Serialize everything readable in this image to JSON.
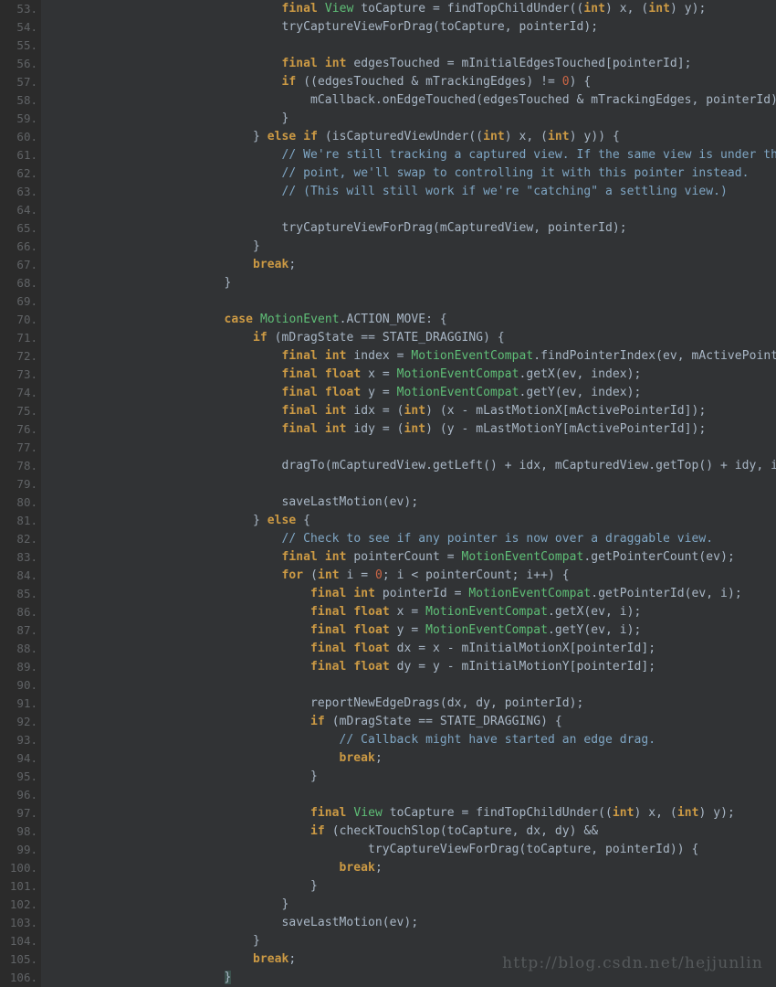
{
  "editor": {
    "language": "java",
    "first_line_number": 53,
    "last_line_number": 106,
    "line_number_suffix": ".",
    "colors": {
      "background": "#313335",
      "gutter_background": "#2b2b2b",
      "line_number": "#606366",
      "default_text": "#a9b7c6",
      "keyword": "#cc9a44",
      "type": "#5fbf77",
      "number": "#cc6645",
      "comment": "#7fa6c4",
      "brace_match_highlight": "#3b514d",
      "watermark": "#565a5c"
    }
  },
  "watermark": {
    "text": "http://blog.csdn.net/hejjunlin"
  },
  "lines": [
    {
      "num": "53.",
      "tokens": [
        {
          "t": "p",
          "s": "                    "
        },
        {
          "t": "k",
          "s": "final"
        },
        {
          "t": "p",
          "s": " "
        },
        {
          "t": "t",
          "s": "View"
        },
        {
          "t": "p",
          "s": " toCapture = findTopChildUnder(("
        },
        {
          "t": "k",
          "s": "int"
        },
        {
          "t": "p",
          "s": ") x, ("
        },
        {
          "t": "k",
          "s": "int"
        },
        {
          "t": "p",
          "s": ") y);"
        }
      ]
    },
    {
      "num": "54.",
      "tokens": [
        {
          "t": "p",
          "s": "                    tryCaptureViewForDrag(toCapture, pointerId);"
        }
      ]
    },
    {
      "num": "55.",
      "tokens": [
        {
          "t": "p",
          "s": ""
        }
      ]
    },
    {
      "num": "56.",
      "tokens": [
        {
          "t": "p",
          "s": "                    "
        },
        {
          "t": "k",
          "s": "final"
        },
        {
          "t": "p",
          "s": " "
        },
        {
          "t": "k",
          "s": "int"
        },
        {
          "t": "p",
          "s": " edgesTouched = mInitialEdgesTouched[pointerId];"
        }
      ]
    },
    {
      "num": "57.",
      "tokens": [
        {
          "t": "p",
          "s": "                    "
        },
        {
          "t": "k",
          "s": "if"
        },
        {
          "t": "p",
          "s": " ((edgesTouched & mTrackingEdges) != "
        },
        {
          "t": "n",
          "s": "0"
        },
        {
          "t": "p",
          "s": ") {"
        }
      ]
    },
    {
      "num": "58.",
      "tokens": [
        {
          "t": "p",
          "s": "                        mCallback.onEdgeTouched(edgesTouched & mTrackingEdges, pointerId);"
        }
      ]
    },
    {
      "num": "59.",
      "tokens": [
        {
          "t": "p",
          "s": "                    }"
        }
      ]
    },
    {
      "num": "60.",
      "tokens": [
        {
          "t": "p",
          "s": "                "
        },
        {
          "t": "p",
          "s": "} "
        },
        {
          "t": "k",
          "s": "else"
        },
        {
          "t": "p",
          "s": " "
        },
        {
          "t": "k",
          "s": "if"
        },
        {
          "t": "p",
          "s": " (isCapturedViewUnder(("
        },
        {
          "t": "k",
          "s": "int"
        },
        {
          "t": "p",
          "s": ") x, ("
        },
        {
          "t": "k",
          "s": "int"
        },
        {
          "t": "p",
          "s": ") y)) {"
        }
      ]
    },
    {
      "num": "61.",
      "tokens": [
        {
          "t": "p",
          "s": "                    "
        },
        {
          "t": "c",
          "s": "// We're still tracking a captured view. If the same view is under this"
        }
      ]
    },
    {
      "num": "62.",
      "tokens": [
        {
          "t": "p",
          "s": "                    "
        },
        {
          "t": "c",
          "s": "// point, we'll swap to controlling it with this pointer instead."
        }
      ]
    },
    {
      "num": "63.",
      "tokens": [
        {
          "t": "p",
          "s": "                    "
        },
        {
          "t": "c",
          "s": "// (This will still work if we're \"catching\" a settling view.)"
        }
      ]
    },
    {
      "num": "64.",
      "tokens": [
        {
          "t": "p",
          "s": ""
        }
      ]
    },
    {
      "num": "65.",
      "tokens": [
        {
          "t": "p",
          "s": "                    tryCaptureViewForDrag(mCapturedView, pointerId);"
        }
      ]
    },
    {
      "num": "66.",
      "tokens": [
        {
          "t": "p",
          "s": "                }"
        }
      ]
    },
    {
      "num": "67.",
      "tokens": [
        {
          "t": "p",
          "s": "                "
        },
        {
          "t": "k",
          "s": "break"
        },
        {
          "t": "p",
          "s": ";"
        }
      ]
    },
    {
      "num": "68.",
      "tokens": [
        {
          "t": "p",
          "s": "            }"
        }
      ]
    },
    {
      "num": "69.",
      "tokens": [
        {
          "t": "p",
          "s": ""
        }
      ]
    },
    {
      "num": "70.",
      "tokens": [
        {
          "t": "p",
          "s": "            "
        },
        {
          "t": "k",
          "s": "case"
        },
        {
          "t": "p",
          "s": " "
        },
        {
          "t": "t",
          "s": "MotionEvent"
        },
        {
          "t": "p",
          "s": ".ACTION_MOVE: {"
        }
      ]
    },
    {
      "num": "71.",
      "tokens": [
        {
          "t": "p",
          "s": "                "
        },
        {
          "t": "k",
          "s": "if"
        },
        {
          "t": "p",
          "s": " (mDragState == STATE_DRAGGING) {"
        }
      ]
    },
    {
      "num": "72.",
      "tokens": [
        {
          "t": "p",
          "s": "                    "
        },
        {
          "t": "k",
          "s": "final"
        },
        {
          "t": "p",
          "s": " "
        },
        {
          "t": "k",
          "s": "int"
        },
        {
          "t": "p",
          "s": " index = "
        },
        {
          "t": "t",
          "s": "MotionEventCompat"
        },
        {
          "t": "p",
          "s": ".findPointerIndex(ev, mActivePointerId);"
        }
      ]
    },
    {
      "num": "73.",
      "tokens": [
        {
          "t": "p",
          "s": "                    "
        },
        {
          "t": "k",
          "s": "final"
        },
        {
          "t": "p",
          "s": " "
        },
        {
          "t": "k",
          "s": "float"
        },
        {
          "t": "p",
          "s": " x = "
        },
        {
          "t": "t",
          "s": "MotionEventCompat"
        },
        {
          "t": "p",
          "s": ".getX(ev, index);"
        }
      ]
    },
    {
      "num": "74.",
      "tokens": [
        {
          "t": "p",
          "s": "                    "
        },
        {
          "t": "k",
          "s": "final"
        },
        {
          "t": "p",
          "s": " "
        },
        {
          "t": "k",
          "s": "float"
        },
        {
          "t": "p",
          "s": " y = "
        },
        {
          "t": "t",
          "s": "MotionEventCompat"
        },
        {
          "t": "p",
          "s": ".getY(ev, index);"
        }
      ]
    },
    {
      "num": "75.",
      "tokens": [
        {
          "t": "p",
          "s": "                    "
        },
        {
          "t": "k",
          "s": "final"
        },
        {
          "t": "p",
          "s": " "
        },
        {
          "t": "k",
          "s": "int"
        },
        {
          "t": "p",
          "s": " idx = ("
        },
        {
          "t": "k",
          "s": "int"
        },
        {
          "t": "p",
          "s": ") (x - mLastMotionX[mActivePointerId]);"
        }
      ]
    },
    {
      "num": "76.",
      "tokens": [
        {
          "t": "p",
          "s": "                    "
        },
        {
          "t": "k",
          "s": "final"
        },
        {
          "t": "p",
          "s": " "
        },
        {
          "t": "k",
          "s": "int"
        },
        {
          "t": "p",
          "s": " idy = ("
        },
        {
          "t": "k",
          "s": "int"
        },
        {
          "t": "p",
          "s": ") (y - mLastMotionY[mActivePointerId]);"
        }
      ]
    },
    {
      "num": "77.",
      "tokens": [
        {
          "t": "p",
          "s": ""
        }
      ]
    },
    {
      "num": "78.",
      "tokens": [
        {
          "t": "p",
          "s": "                    dragTo(mCapturedView.getLeft() + idx, mCapturedView.getTop() + idy, idx, idy);"
        }
      ]
    },
    {
      "num": "79.",
      "tokens": [
        {
          "t": "p",
          "s": ""
        }
      ]
    },
    {
      "num": "80.",
      "tokens": [
        {
          "t": "p",
          "s": "                    saveLastMotion(ev);"
        }
      ]
    },
    {
      "num": "81.",
      "tokens": [
        {
          "t": "p",
          "s": "                } "
        },
        {
          "t": "k",
          "s": "else"
        },
        {
          "t": "p",
          "s": " {"
        }
      ]
    },
    {
      "num": "82.",
      "tokens": [
        {
          "t": "p",
          "s": "                    "
        },
        {
          "t": "c",
          "s": "// Check to see if any pointer is now over a draggable view."
        }
      ]
    },
    {
      "num": "83.",
      "tokens": [
        {
          "t": "p",
          "s": "                    "
        },
        {
          "t": "k",
          "s": "final"
        },
        {
          "t": "p",
          "s": " "
        },
        {
          "t": "k",
          "s": "int"
        },
        {
          "t": "p",
          "s": " pointerCount = "
        },
        {
          "t": "t",
          "s": "MotionEventCompat"
        },
        {
          "t": "p",
          "s": ".getPointerCount(ev);"
        }
      ]
    },
    {
      "num": "84.",
      "tokens": [
        {
          "t": "p",
          "s": "                    "
        },
        {
          "t": "k",
          "s": "for"
        },
        {
          "t": "p",
          "s": " ("
        },
        {
          "t": "k",
          "s": "int"
        },
        {
          "t": "p",
          "s": " i = "
        },
        {
          "t": "n",
          "s": "0"
        },
        {
          "t": "p",
          "s": "; i < pointerCount; i++) {"
        }
      ]
    },
    {
      "num": "85.",
      "tokens": [
        {
          "t": "p",
          "s": "                        "
        },
        {
          "t": "k",
          "s": "final"
        },
        {
          "t": "p",
          "s": " "
        },
        {
          "t": "k",
          "s": "int"
        },
        {
          "t": "p",
          "s": " pointerId = "
        },
        {
          "t": "t",
          "s": "MotionEventCompat"
        },
        {
          "t": "p",
          "s": ".getPointerId(ev, i);"
        }
      ]
    },
    {
      "num": "86.",
      "tokens": [
        {
          "t": "p",
          "s": "                        "
        },
        {
          "t": "k",
          "s": "final"
        },
        {
          "t": "p",
          "s": " "
        },
        {
          "t": "k",
          "s": "float"
        },
        {
          "t": "p",
          "s": " x = "
        },
        {
          "t": "t",
          "s": "MotionEventCompat"
        },
        {
          "t": "p",
          "s": ".getX(ev, i);"
        }
      ]
    },
    {
      "num": "87.",
      "tokens": [
        {
          "t": "p",
          "s": "                        "
        },
        {
          "t": "k",
          "s": "final"
        },
        {
          "t": "p",
          "s": " "
        },
        {
          "t": "k",
          "s": "float"
        },
        {
          "t": "p",
          "s": " y = "
        },
        {
          "t": "t",
          "s": "MotionEventCompat"
        },
        {
          "t": "p",
          "s": ".getY(ev, i);"
        }
      ]
    },
    {
      "num": "88.",
      "tokens": [
        {
          "t": "p",
          "s": "                        "
        },
        {
          "t": "k",
          "s": "final"
        },
        {
          "t": "p",
          "s": " "
        },
        {
          "t": "k",
          "s": "float"
        },
        {
          "t": "p",
          "s": " dx = x - mInitialMotionX[pointerId];"
        }
      ]
    },
    {
      "num": "89.",
      "tokens": [
        {
          "t": "p",
          "s": "                        "
        },
        {
          "t": "k",
          "s": "final"
        },
        {
          "t": "p",
          "s": " "
        },
        {
          "t": "k",
          "s": "float"
        },
        {
          "t": "p",
          "s": " dy = y - mInitialMotionY[pointerId];"
        }
      ]
    },
    {
      "num": "90.",
      "tokens": [
        {
          "t": "p",
          "s": ""
        }
      ]
    },
    {
      "num": "91.",
      "tokens": [
        {
          "t": "p",
          "s": "                        reportNewEdgeDrags(dx, dy, pointerId);"
        }
      ]
    },
    {
      "num": "92.",
      "tokens": [
        {
          "t": "p",
          "s": "                        "
        },
        {
          "t": "k",
          "s": "if"
        },
        {
          "t": "p",
          "s": " (mDragState == STATE_DRAGGING) {"
        }
      ]
    },
    {
      "num": "93.",
      "tokens": [
        {
          "t": "p",
          "s": "                            "
        },
        {
          "t": "c",
          "s": "// Callback might have started an edge drag."
        }
      ]
    },
    {
      "num": "94.",
      "tokens": [
        {
          "t": "p",
          "s": "                            "
        },
        {
          "t": "k",
          "s": "break"
        },
        {
          "t": "p",
          "s": ";"
        }
      ]
    },
    {
      "num": "95.",
      "tokens": [
        {
          "t": "p",
          "s": "                        }"
        }
      ]
    },
    {
      "num": "96.",
      "tokens": [
        {
          "t": "p",
          "s": ""
        }
      ]
    },
    {
      "num": "97.",
      "tokens": [
        {
          "t": "p",
          "s": "                        "
        },
        {
          "t": "k",
          "s": "final"
        },
        {
          "t": "p",
          "s": " "
        },
        {
          "t": "t",
          "s": "View"
        },
        {
          "t": "p",
          "s": " toCapture = findTopChildUnder(("
        },
        {
          "t": "k",
          "s": "int"
        },
        {
          "t": "p",
          "s": ") x, ("
        },
        {
          "t": "k",
          "s": "int"
        },
        {
          "t": "p",
          "s": ") y);"
        }
      ]
    },
    {
      "num": "98.",
      "tokens": [
        {
          "t": "p",
          "s": "                        "
        },
        {
          "t": "k",
          "s": "if"
        },
        {
          "t": "p",
          "s": " (checkTouchSlop(toCapture, dx, dy) &&"
        }
      ]
    },
    {
      "num": "99.",
      "tokens": [
        {
          "t": "p",
          "s": "                                tryCaptureViewForDrag(toCapture, pointerId)) {"
        }
      ]
    },
    {
      "num": "100.",
      "tokens": [
        {
          "t": "p",
          "s": "                            "
        },
        {
          "t": "k",
          "s": "break"
        },
        {
          "t": "p",
          "s": ";"
        }
      ]
    },
    {
      "num": "101.",
      "tokens": [
        {
          "t": "p",
          "s": "                        }"
        }
      ]
    },
    {
      "num": "102.",
      "tokens": [
        {
          "t": "p",
          "s": "                    }"
        }
      ]
    },
    {
      "num": "103.",
      "tokens": [
        {
          "t": "p",
          "s": "                    saveLastMotion(ev);"
        }
      ]
    },
    {
      "num": "104.",
      "tokens": [
        {
          "t": "p",
          "s": "                }"
        }
      ]
    },
    {
      "num": "105.",
      "tokens": [
        {
          "t": "p",
          "s": "                "
        },
        {
          "t": "k",
          "s": "break"
        },
        {
          "t": "p",
          "s": ";"
        }
      ]
    },
    {
      "num": "106.",
      "tokens": [
        {
          "t": "p",
          "s": "            "
        },
        {
          "t": "br",
          "s": "}"
        }
      ]
    }
  ]
}
